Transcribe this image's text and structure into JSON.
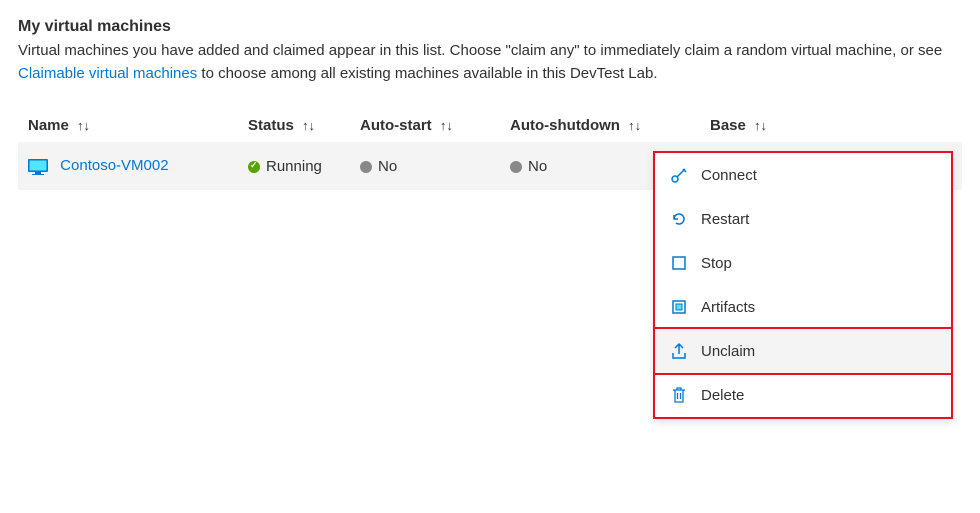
{
  "section": {
    "title": "My virtual machines",
    "description_pre": "Virtual machines you have added and claimed appear in this list. Choose \"claim any\" to immediately claim a random virtual machine, or see ",
    "description_link": "Claimable virtual machines",
    "description_post": " to choose among all existing machines available in this DevTest Lab."
  },
  "columns": {
    "name": "Name",
    "status": "Status",
    "autostart": "Auto-start",
    "autoshutdown": "Auto-shutdown",
    "base": "Base"
  },
  "row": {
    "name": "Contoso-VM002",
    "status": "Running",
    "autostart": "No",
    "autoshutdown": "No",
    "base": ""
  },
  "menu": {
    "connect": "Connect",
    "restart": "Restart",
    "stop": "Stop",
    "artifacts": "Artifacts",
    "unclaim": "Unclaim",
    "delete": "Delete"
  }
}
